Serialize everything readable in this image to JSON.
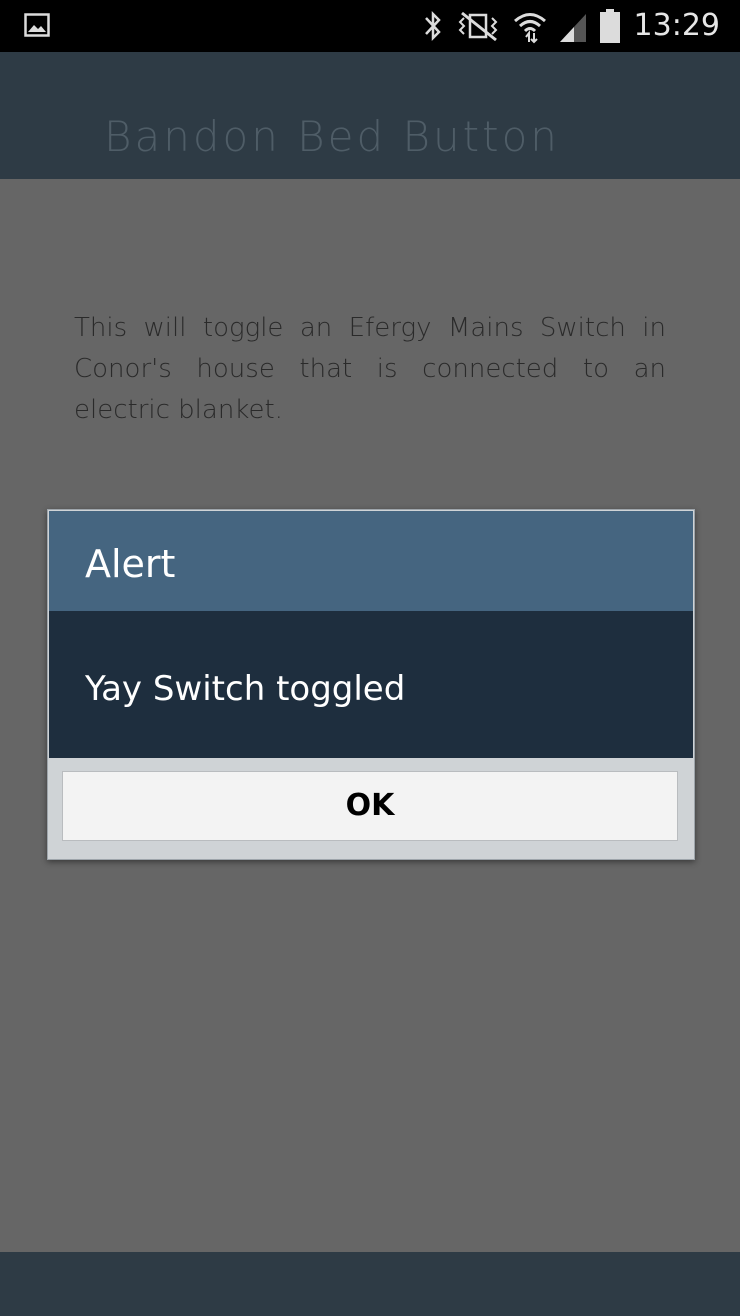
{
  "status_bar": {
    "time": "13:29",
    "icons": [
      "gallery-icon",
      "bluetooth-icon",
      "vibrate-mute-icon",
      "wifi-icon",
      "signal-icon",
      "battery-icon"
    ]
  },
  "app": {
    "title": "Bandon Bed Button",
    "description": "This will toggle an Efergy Mains Switch in Conor's house that is connected to an electric blanket."
  },
  "dialog": {
    "title": "Alert",
    "message": "Yay Switch toggled",
    "ok_label": "OK"
  },
  "colors": {
    "header": "#2e3b45",
    "dialog_header": "#456580",
    "dialog_body": "#1e2e3e",
    "overlay": "#666666"
  }
}
